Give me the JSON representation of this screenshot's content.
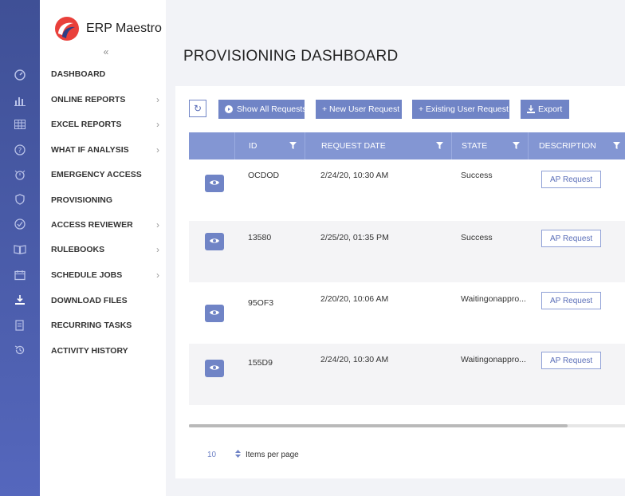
{
  "app": {
    "brand": "ERP Maestro",
    "collapse_glyph": "«"
  },
  "nav": {
    "items": [
      {
        "label": "DASHBOARD",
        "chevron": false
      },
      {
        "label": "ONLINE REPORTS",
        "chevron": true
      },
      {
        "label": "EXCEL REPORTS",
        "chevron": true
      },
      {
        "label": "WHAT IF ANALYSIS",
        "chevron": true
      },
      {
        "label": "EMERGENCY ACCESS",
        "chevron": false
      },
      {
        "label": "PROVISIONING",
        "chevron": false
      },
      {
        "label": "ACCESS REVIEWER",
        "chevron": true
      },
      {
        "label": "RULEBOOKS",
        "chevron": true
      },
      {
        "label": "SCHEDULE JOBS",
        "chevron": true
      },
      {
        "label": "DOWNLOAD FILES",
        "chevron": false
      },
      {
        "label": "RECURRING TASKS",
        "chevron": false
      },
      {
        "label": "ACTIVITY HISTORY",
        "chevron": false
      }
    ],
    "chevron_glyph": "›"
  },
  "rail_icons": [
    "gauge-icon",
    "bar-chart-icon",
    "grid-icon",
    "help-circle-icon",
    "alarm-icon",
    "shield-icon",
    "check-circle-icon",
    "book-icon",
    "calendar-icon",
    "download-icon",
    "file-icon",
    "history-icon"
  ],
  "page": {
    "title": "PROVISIONING DASHBOARD"
  },
  "toolbar": {
    "refresh_glyph": "↻",
    "show_all": "Show All Requests",
    "new_user": "+ New User Request",
    "existing_user": "+ Existing User Request",
    "export": "Export"
  },
  "table": {
    "columns": [
      "ID",
      "REQUEST DATE",
      "STATE",
      "DESCRIPTION"
    ],
    "rows": [
      {
        "id": "OCDOD",
        "date": "2/24/20, 10:30 AM",
        "state": "Success",
        "desc": "AP Request"
      },
      {
        "id": "13580",
        "date": "2/25/20, 01:35 PM",
        "state": "Success",
        "desc": "AP Request"
      },
      {
        "id": "95OF3",
        "date": "2/20/20, 10:06 AM",
        "state": "Waitingonappro...",
        "desc": "AP Request"
      },
      {
        "id": "155D9",
        "date": "2/24/20, 10:30 AM",
        "state": "Waitingonappro...",
        "desc": "AP Request"
      }
    ]
  },
  "pager": {
    "page_size": "10",
    "label": "Items per page"
  },
  "colors": {
    "accent": "#7084c6",
    "header": "#8396d3",
    "rail": "#4e60b0"
  }
}
